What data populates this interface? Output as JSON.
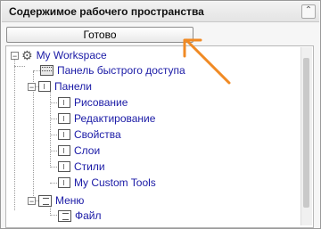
{
  "panel": {
    "title": "Содержимое рабочего пространства"
  },
  "toolbar": {
    "done_label": "Готово"
  },
  "tree": {
    "root": "My Workspace",
    "quick_access": "Панель быстрого доступа",
    "toolbars": "Панели",
    "toolbar_items": [
      "Рисование",
      "Редактирование",
      "Свойства",
      "Слои",
      "Стили",
      "My Custom Tools"
    ],
    "menu": "Меню",
    "menu_items": [
      "Файл"
    ]
  },
  "colors": {
    "label": "#1a1aa6",
    "arrow": "#f08a24"
  }
}
